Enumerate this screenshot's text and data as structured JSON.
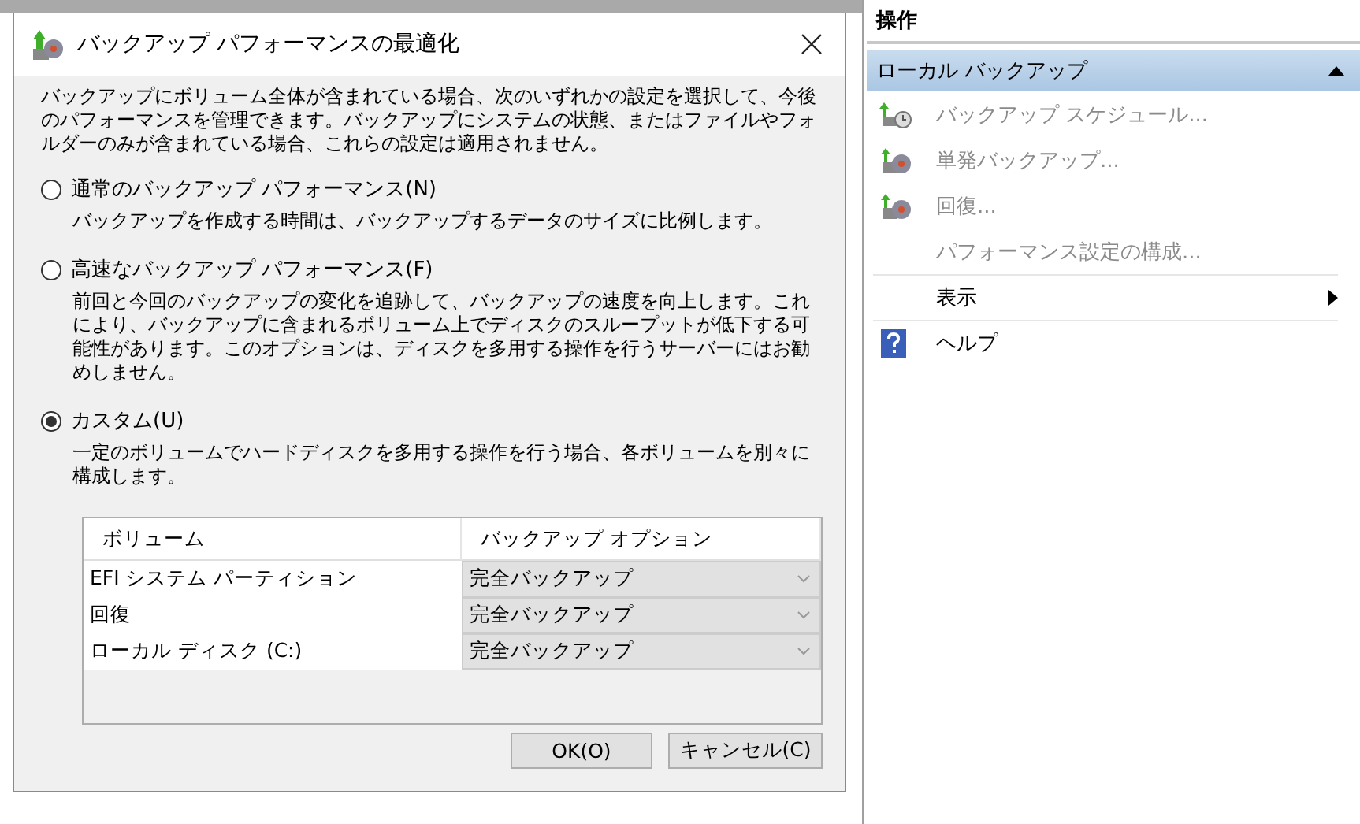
{
  "dialog": {
    "title": "バックアップ パフォーマンスの最適化",
    "intro": "バックアップにボリューム全体が含まれている場合、次のいずれかの設定を選択して、今後のパフォーマンスを管理できます。バックアップにシステムの状態、またはファイルやフォルダーのみが含まれている場合、これらの設定は適用されません。",
    "options": [
      {
        "label": "通常のバックアップ パフォーマンス(N)",
        "description": "バックアップを作成する時間は、バックアップするデータのサイズに比例します。",
        "selected": false
      },
      {
        "label": "高速なバックアップ パフォーマンス(F)",
        "description": "前回と今回のバックアップの変化を追跡して、バックアップの速度を向上します。これにより、バックアップに含まれるボリューム上でディスクのスループットが低下する可能性があります。このオプションは、ディスクを多用する操作を行うサーバーにはお勧めしません。",
        "selected": false
      },
      {
        "label": "カスタム(U)",
        "description": "一定のボリュームでハードディスクを多用する操作を行う場合、各ボリュームを別々に構成します。",
        "selected": true
      }
    ],
    "table": {
      "columns": [
        "ボリューム",
        "バックアップ オプション"
      ],
      "rows": [
        {
          "volume": "EFI システム パーティション",
          "option": "完全バックアップ"
        },
        {
          "volume": "回復",
          "option": "完全バックアップ"
        },
        {
          "volume": "ローカル ディスク (C:)",
          "option": "完全バックアップ"
        }
      ]
    },
    "buttons": [
      "OK(O)",
      "キャンセル(C)"
    ]
  },
  "actions": {
    "title": "操作",
    "section": {
      "label": "ローカル バックアップ",
      "expanded": true
    },
    "items": [
      {
        "label": "バックアップ スケジュール...",
        "kind": "schedule",
        "disabled": true,
        "separator_before": false,
        "submenu": false
      },
      {
        "label": "単発バックアップ...",
        "kind": "backup",
        "disabled": true,
        "separator_before": false,
        "submenu": false
      },
      {
        "label": "回復...",
        "kind": "backup",
        "disabled": true,
        "separator_before": false,
        "submenu": false
      },
      {
        "label": "パフォーマンス設定の構成...",
        "kind": "plain",
        "disabled": true,
        "separator_before": false,
        "submenu": false
      },
      {
        "label": "表示",
        "kind": "plain",
        "disabled": false,
        "separator_before": true,
        "submenu": true
      },
      {
        "label": "ヘルプ",
        "kind": "help",
        "disabled": false,
        "separator_before": true,
        "submenu": false
      }
    ]
  }
}
